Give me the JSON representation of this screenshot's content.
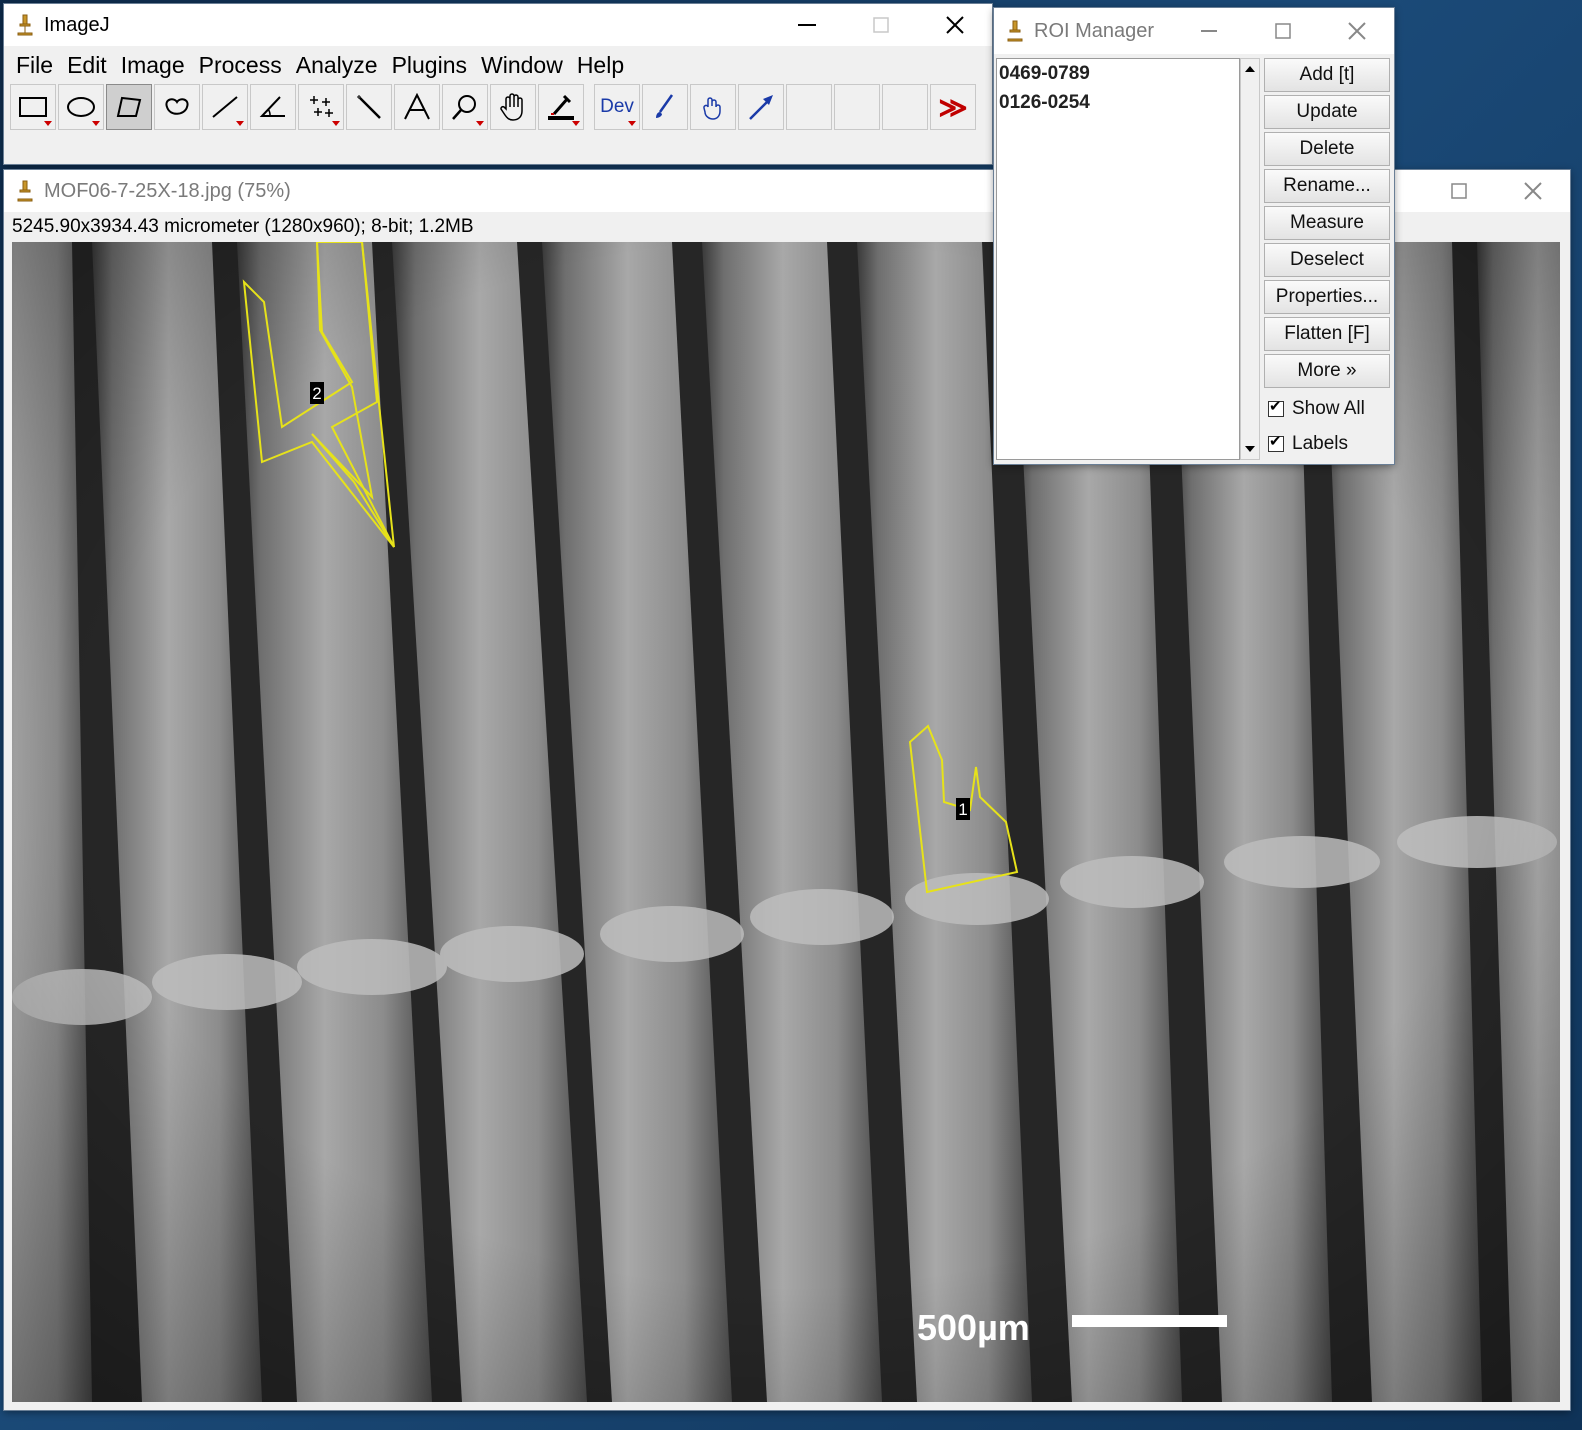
{
  "imagej": {
    "title": "ImageJ",
    "menu": [
      "File",
      "Edit",
      "Image",
      "Process",
      "Analyze",
      "Plugins",
      "Window",
      "Help"
    ],
    "tools": [
      "rectangle",
      "oval",
      "polygon",
      "freehand",
      "line",
      "angle",
      "multi-point",
      "wand",
      "text",
      "magnifier",
      "scroll",
      "color-picker",
      "dev",
      "brush",
      "hand",
      "arrow",
      "empty",
      "empty",
      "empty",
      "more"
    ],
    "dev_label": "Dev",
    "more_symbol": "≫",
    "controls": {
      "minimize": "—",
      "maximize": "☐",
      "close": "✕"
    }
  },
  "image_window": {
    "title": "MOF06-7-25X-18.jpg (75%)",
    "info": "5245.90x3934.43 micrometer (1280x960); 8-bit; 1.2MB",
    "scale_bar_label": "500µm",
    "roi_labels": [
      "1",
      "2"
    ]
  },
  "roi_manager": {
    "title": "ROI Manager",
    "items": [
      "0469-0789",
      "0126-0254"
    ],
    "buttons": [
      "Add [t]",
      "Update",
      "Delete",
      "Rename...",
      "Measure",
      "Deselect",
      "Properties...",
      "Flatten [F]",
      "More »"
    ],
    "checkboxes": [
      {
        "label": "Show All",
        "checked": true
      },
      {
        "label": "Labels",
        "checked": true
      }
    ]
  },
  "colors": {
    "roi_outline": "#e6e21a",
    "accent_red": "#c00000",
    "icon_gold": "#c8962a"
  }
}
